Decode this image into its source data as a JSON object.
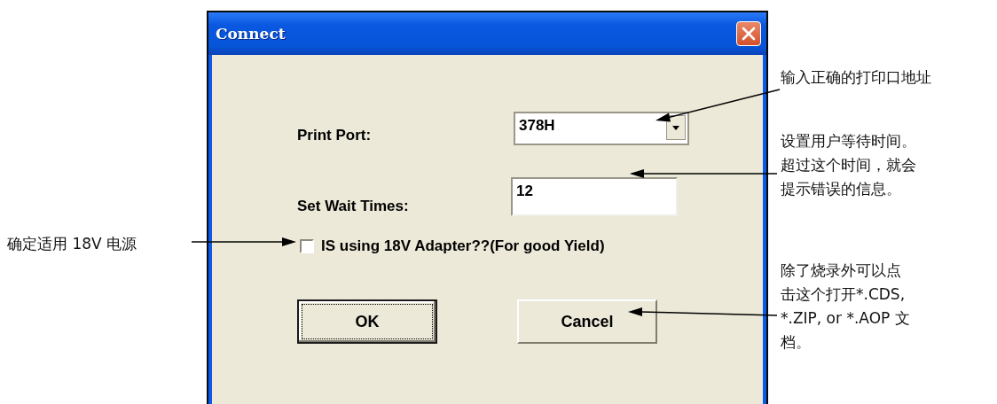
{
  "window": {
    "title": "Connect"
  },
  "fields": [
    {
      "kind": "combo",
      "label": "Print Port:",
      "value": "378H"
    },
    {
      "kind": "text",
      "label": "Set Wait Times:",
      "value": "12"
    }
  ],
  "checkbox": {
    "label": "IS using 18V Adapter??(For good Yield)",
    "checked": false
  },
  "buttons": [
    {
      "label": "OK",
      "default": true
    },
    {
      "label": "Cancel",
      "default": false
    }
  ],
  "annotations": [
    {
      "lines": [
        "输入正确的打印口地址"
      ]
    },
    {
      "lines": [
        "设置用户等待时间。",
        "超过这个时间，就会",
        "提示错误的信息。"
      ]
    },
    {
      "lines": [
        "确定适用 18V  电源"
      ]
    },
    {
      "lines": [
        "除了烧录外可以点",
        "击这个打开*.CDS,",
        "*.ZIP, or *.AOP 文",
        "档。"
      ]
    }
  ]
}
